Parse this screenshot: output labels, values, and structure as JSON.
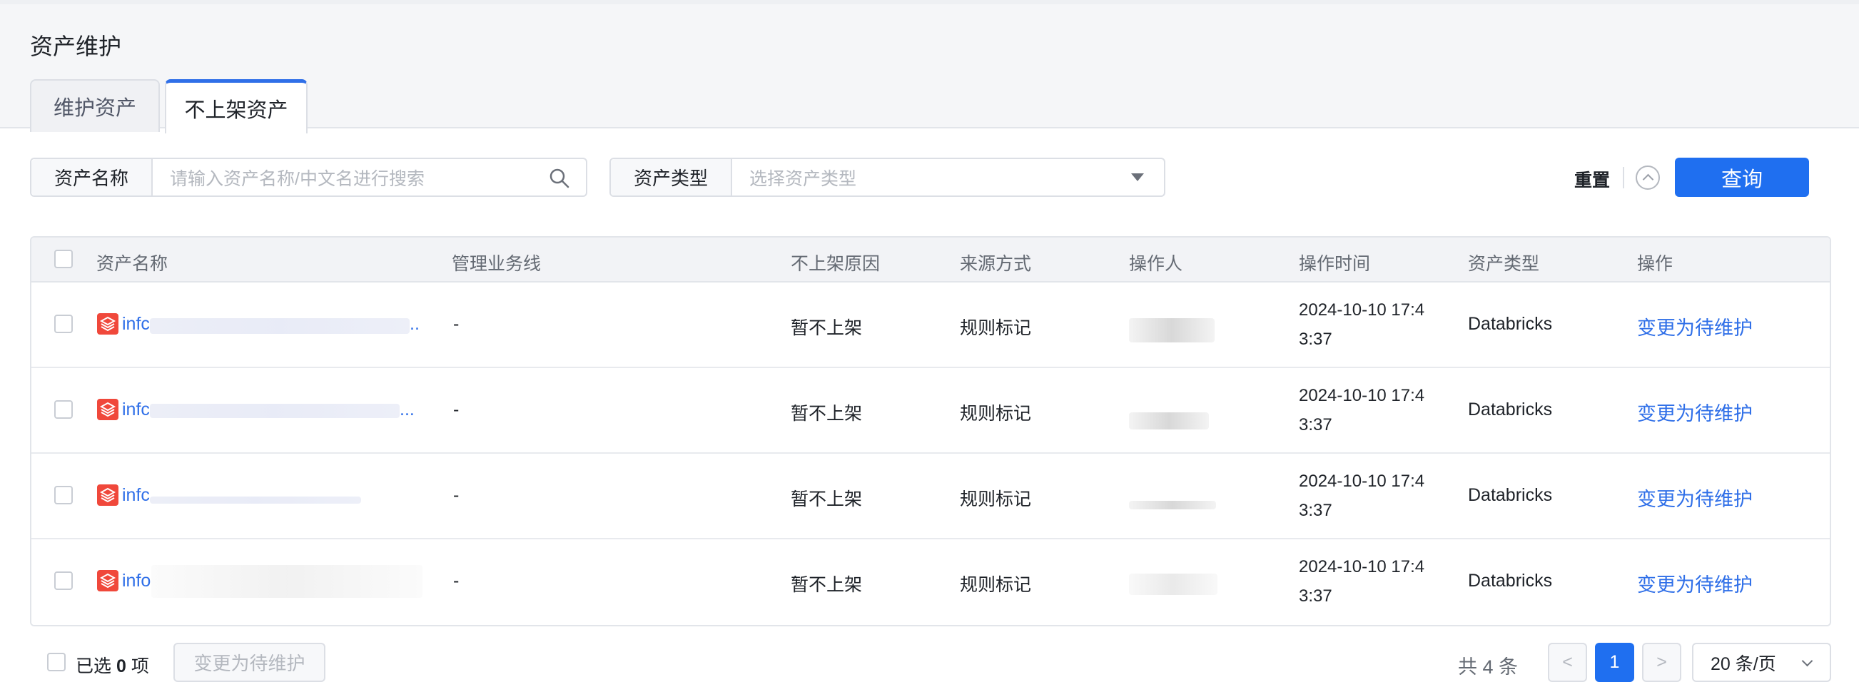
{
  "page": {
    "title": "资产维护",
    "tabs": [
      {
        "label": "维护资产",
        "active": false
      },
      {
        "label": "不上架资产",
        "active": true
      }
    ]
  },
  "filters": {
    "asset_name_label": "资产名称",
    "asset_name_placeholder": "请输入资产名称/中文名进行搜索",
    "asset_type_label": "资产类型",
    "asset_type_placeholder": "选择资产类型",
    "reset_label": "重置",
    "query_label": "查询"
  },
  "table": {
    "columns": [
      "资产名称",
      "管理业务线",
      "不上架原因",
      "来源方式",
      "操作人",
      "操作时间",
      "资产类型",
      "操作"
    ],
    "rows": [
      {
        "name": "infc",
        "suffix": "..",
        "business_line": "-",
        "reason": "暂不上架",
        "source": "规则标记",
        "time_line1": "2024-10-10 17:4",
        "time_line2": "3:37",
        "asset_type": "Databricks",
        "action": "变更为待维护"
      },
      {
        "name": "infc",
        "suffix": "...",
        "business_line": "-",
        "reason": "暂不上架",
        "source": "规则标记",
        "time_line1": "2024-10-10 17:4",
        "time_line2": "3:37",
        "asset_type": "Databricks",
        "action": "变更为待维护"
      },
      {
        "name": "infc",
        "suffix": "",
        "business_line": "-",
        "reason": "暂不上架",
        "source": "规则标记",
        "time_line1": "2024-10-10 17:4",
        "time_line2": "3:37",
        "asset_type": "Databricks",
        "action": "变更为待维护"
      },
      {
        "name": "info",
        "suffix": "",
        "business_line": "-",
        "reason": "暂不上架",
        "source": "规则标记",
        "time_line1": "2024-10-10 17:4",
        "time_line2": "3:37",
        "asset_type": "Databricks",
        "action": "变更为待维护"
      }
    ]
  },
  "footer": {
    "selected_prefix": "已选",
    "selected_count": "0",
    "selected_suffix": "项",
    "batch_action": "变更为待维护",
    "total": "共 4 条",
    "prev": "<",
    "current_page": "1",
    "next": ">",
    "page_size": "20 条/页"
  },
  "colors": {
    "primary": "#1f6ff0",
    "link": "#2f6fe8",
    "databricks_icon": "#f0483b"
  }
}
